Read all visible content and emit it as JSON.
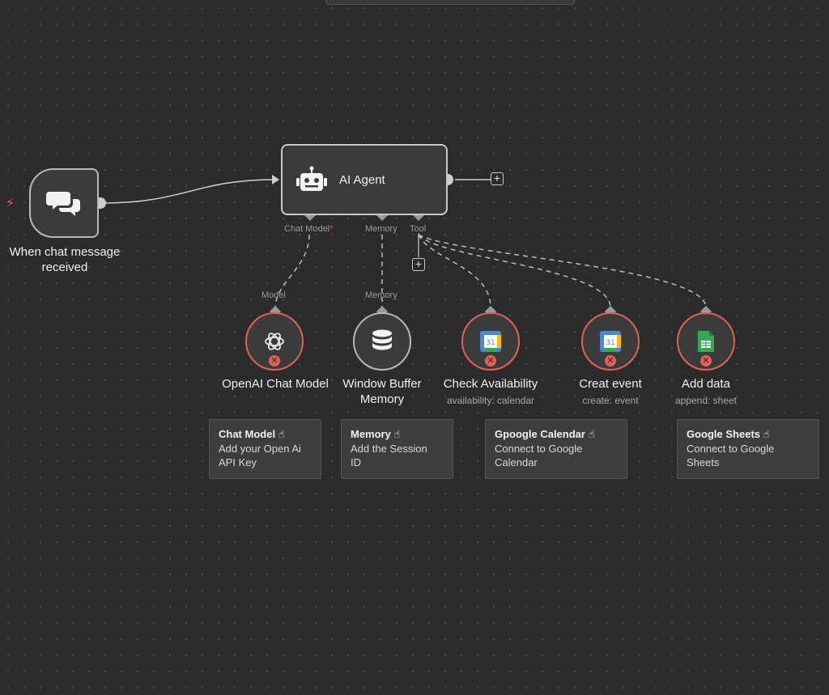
{
  "trigger": {
    "label": "When chat message received"
  },
  "agent": {
    "title": "AI Agent"
  },
  "ports": {
    "chat_model": "Chat Model",
    "required_mark": "*",
    "memory": "Memory",
    "tool": "Tool"
  },
  "sub_ports": {
    "model": "Model",
    "memory": "Memory"
  },
  "nodes": [
    {
      "label": "OpenAI Chat Model",
      "sub": ""
    },
    {
      "label": "Window Buffer Memory",
      "sub": ""
    },
    {
      "label": "Check Availability",
      "sub": "availability: calendar"
    },
    {
      "label": "Creat event",
      "sub": "create: event"
    },
    {
      "label": "Add data",
      "sub": "append: sheet"
    }
  ],
  "notes": [
    {
      "title": "Chat Model ☝",
      "line1": "Add your Open Ai",
      "line2": "API Key"
    },
    {
      "title": "Memory ☝",
      "line1": "Add the Session",
      "line2": "ID"
    },
    {
      "title": "Gpoogle Calendar ☝",
      "line1": "Connect to Google",
      "line2": "Calendar"
    },
    {
      "title": "Google Sheets ☝",
      "line1": "Connect to Google",
      "line2": "Sheets"
    }
  ],
  "colors": {
    "error": "#e0605c",
    "canvas": "#2b2b2b",
    "node": "#3b3b3b"
  }
}
